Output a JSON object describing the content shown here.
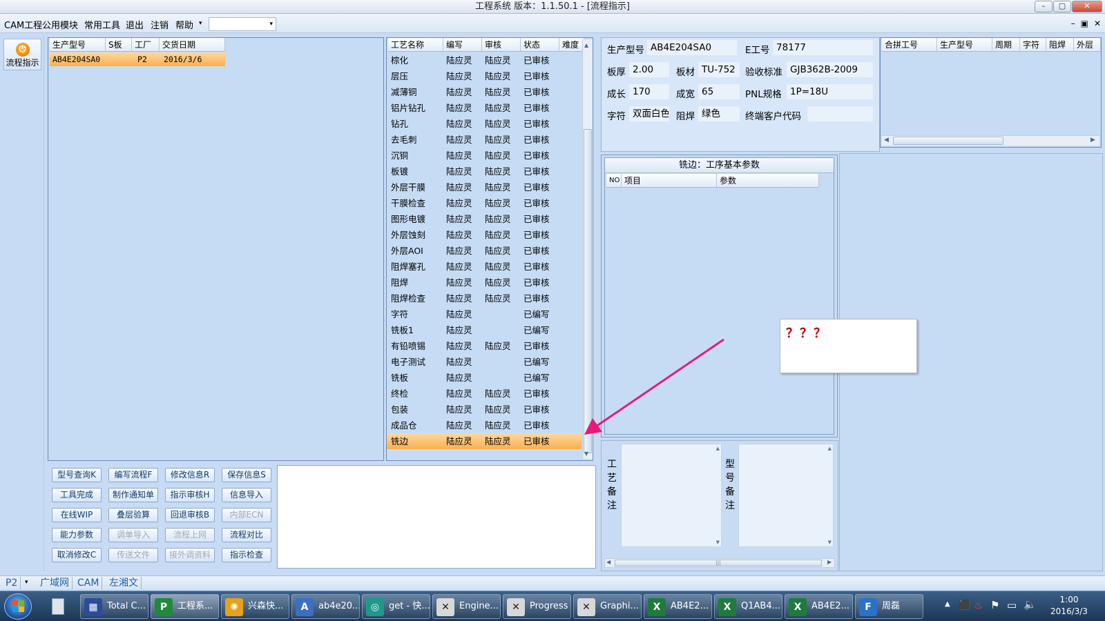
{
  "window": {
    "title": "工程系统  版本：1.1.50.1 - [流程指示]",
    "minimize": "–",
    "maximize": "▢",
    "close": "✕"
  },
  "menu": {
    "items": [
      "CAM工程",
      "公用模块",
      "常用工具",
      "退出",
      "注销",
      "帮助"
    ],
    "dropdown_arrow": "▾",
    "combo_arrow": "▾",
    "mdi_min": "–",
    "mdi_restore": "▣",
    "mdi_close": "✕"
  },
  "sidebar": {
    "flow_button": "流程指示"
  },
  "order_table": {
    "headers": [
      "生产型号",
      "S板",
      "工厂",
      "交货日期"
    ],
    "rows": [
      {
        "model": "AB4E204SA0",
        "s": "",
        "factory": "P2",
        "date": "2016/3/6"
      }
    ]
  },
  "process_table": {
    "headers": [
      "工艺名称",
      "编写",
      "审核",
      "状态",
      "难度"
    ],
    "rows": [
      {
        "name": "棕化",
        "writer": "陆应灵",
        "reviewer": "陆应灵",
        "status": "已审核"
      },
      {
        "name": "层压",
        "writer": "陆应灵",
        "reviewer": "陆应灵",
        "status": "已审核"
      },
      {
        "name": "减薄铜",
        "writer": "陆应灵",
        "reviewer": "陆应灵",
        "status": "已审核"
      },
      {
        "name": "铝片钻孔",
        "writer": "陆应灵",
        "reviewer": "陆应灵",
        "status": "已审核"
      },
      {
        "name": "钻孔",
        "writer": "陆应灵",
        "reviewer": "陆应灵",
        "status": "已审核"
      },
      {
        "name": "去毛刺",
        "writer": "陆应灵",
        "reviewer": "陆应灵",
        "status": "已审核"
      },
      {
        "name": "沉铜",
        "writer": "陆应灵",
        "reviewer": "陆应灵",
        "status": "已审核"
      },
      {
        "name": "板镀",
        "writer": "陆应灵",
        "reviewer": "陆应灵",
        "status": "已审核"
      },
      {
        "name": "外层干膜",
        "writer": "陆应灵",
        "reviewer": "陆应灵",
        "status": "已审核"
      },
      {
        "name": "干膜检查",
        "writer": "陆应灵",
        "reviewer": "陆应灵",
        "status": "已审核"
      },
      {
        "name": "图形电镀",
        "writer": "陆应灵",
        "reviewer": "陆应灵",
        "status": "已审核"
      },
      {
        "name": "外层蚀刻",
        "writer": "陆应灵",
        "reviewer": "陆应灵",
        "status": "已审核"
      },
      {
        "name": "外层AOI",
        "writer": "陆应灵",
        "reviewer": "陆应灵",
        "status": "已审核"
      },
      {
        "name": "阻焊塞孔",
        "writer": "陆应灵",
        "reviewer": "陆应灵",
        "status": "已审核"
      },
      {
        "name": "阻焊",
        "writer": "陆应灵",
        "reviewer": "陆应灵",
        "status": "已审核"
      },
      {
        "name": "阻焊检查",
        "writer": "陆应灵",
        "reviewer": "陆应灵",
        "status": "已审核"
      },
      {
        "name": "字符",
        "writer": "陆应灵",
        "reviewer": "",
        "status": "已编写"
      },
      {
        "name": "铣板1",
        "writer": "陆应灵",
        "reviewer": "",
        "status": "已编写"
      },
      {
        "name": "有铅喷锡",
        "writer": "陆应灵",
        "reviewer": "陆应灵",
        "status": "已审核"
      },
      {
        "name": "电子测试",
        "writer": "陆应灵",
        "reviewer": "",
        "status": "已编写"
      },
      {
        "name": "铣板",
        "writer": "陆应灵",
        "reviewer": "",
        "status": "已编写"
      },
      {
        "name": "终检",
        "writer": "陆应灵",
        "reviewer": "陆应灵",
        "status": "已审核"
      },
      {
        "name": "包装",
        "writer": "陆应灵",
        "reviewer": "陆应灵",
        "status": "已审核"
      },
      {
        "name": "成品仓",
        "writer": "陆应灵",
        "reviewer": "陆应灵",
        "status": "已审核"
      },
      {
        "name": "铣边",
        "writer": "陆应灵",
        "reviewer": "陆应灵",
        "status": "已审核"
      }
    ],
    "selected_row": 24
  },
  "product_info": {
    "model_label": "生产型号",
    "model": "AB4E204SA0",
    "eno_label": "E工号",
    "eno": "78177",
    "thickness_label": "板厚",
    "thickness": "2.00",
    "material_label": "板材",
    "material": "TU-752",
    "standard_label": "验收标准",
    "standard": "GJB362B-2009",
    "length_label": "成长",
    "length": "170",
    "width_label": "成宽",
    "width": "65",
    "pnl_label": "PNL规格",
    "pnl": "1P=18U",
    "char_label": "字符",
    "char": "双面白色",
    "mask_label": "阻焊",
    "mask": "绿色",
    "customer_label": "终端客户代码",
    "customer": ""
  },
  "merge_table": {
    "headers": [
      "合拼工号",
      "生产型号",
      "周期",
      "字符",
      "阻焊",
      "外层"
    ],
    "scroll_left": "◀",
    "scroll_right": "▶"
  },
  "params_panel": {
    "title": "铣边：工序基本参数",
    "headers": [
      "NO",
      "项目",
      "参数"
    ]
  },
  "tooltip": {
    "text": "？？？"
  },
  "notes": {
    "process_label": "工艺备注",
    "model_label": "型号备注",
    "scroll_up": "▲",
    "scroll_down": "▼",
    "hscroll_left": "◀",
    "hscroll_right": "▶",
    "hscroll_thumb": "|||"
  },
  "buttons": [
    [
      "型号查询K",
      "编写流程F",
      "修改信息R",
      "保存信息S"
    ],
    [
      "工具完成",
      "制作通知单",
      "指示审核H",
      "信息导入"
    ],
    [
      "在线WIP",
      "叠层验算",
      "回退审核B",
      "内部ECN"
    ],
    [
      "能力参数",
      "调单导入",
      "流程上网",
      "流程对比"
    ],
    [
      "取消修改C",
      "传送文件",
      "接外调资料",
      "指示检查"
    ]
  ],
  "disabled_buttons": [
    "内部ECN",
    "调单导入",
    "流程上网",
    "传送文件",
    "接外调资料"
  ],
  "statusbar": {
    "factory": "P2",
    "tabs": [
      "广域网",
      "CAM",
      "左湘文"
    ]
  },
  "taskbar": {
    "items": [
      "Total C...",
      "工程系...",
      "兴森快...",
      "ab4e20...",
      "get - 快...",
      "Engine...",
      "Progress",
      "Graphi...",
      "AB4E2...",
      "Q1AB4...",
      "AB4E2...",
      "周磊"
    ],
    "time": "1:00",
    "date": "2016/3/3"
  },
  "colors": {
    "selection": "#f8b04e",
    "arrow": "#e8197a",
    "question": "#c00000"
  }
}
